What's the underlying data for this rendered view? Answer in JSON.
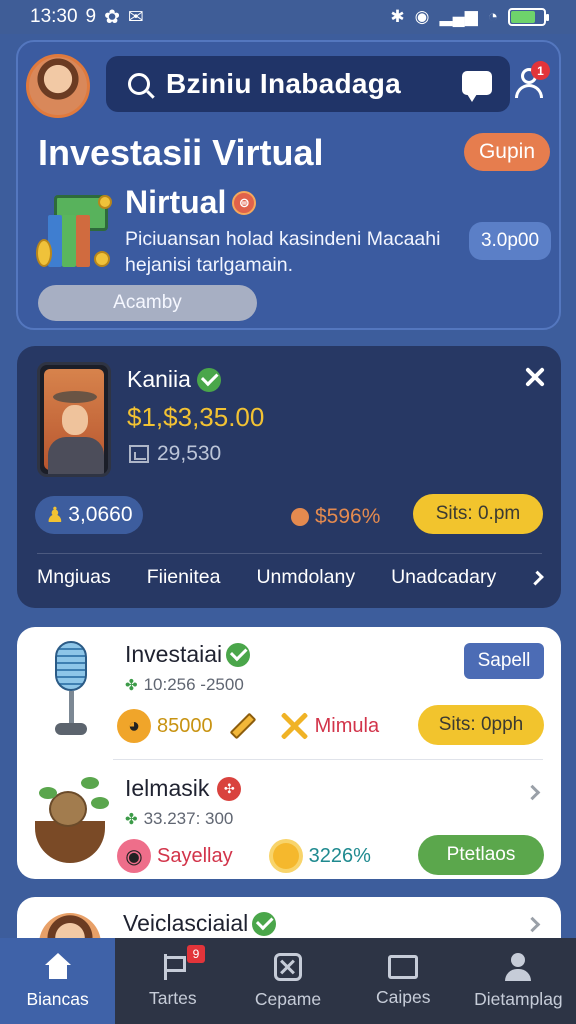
{
  "status_bar": {
    "time": "13:30",
    "extra": "9",
    "colors": {
      "battery": "#6ed36b"
    },
    "battery_level": 0.75
  },
  "header": {
    "search_text": "Bziniu Inabadaga",
    "notification_count": "1",
    "hero_title": "Investasii Virtual",
    "gupin_label": "Gupin",
    "hero_subtitle": "Nirtual",
    "hero_description": "Piciuansan holad kasindeni Macaahi hejanisi tarlgamain.",
    "amount_label": "3.0p00",
    "acamby_label": "Acamby"
  },
  "profile": {
    "name": "Kaniia",
    "balance": "$1,$3,35.00",
    "stat": "29,530",
    "points": "3,0660",
    "percent": "$596%",
    "sits_label": "Sits: 0.pm",
    "tabs": [
      "Mngiuas",
      "Fiienitea",
      "Unmdolany",
      "Unadcadary"
    ]
  },
  "list": {
    "items": [
      {
        "title": "Investaiai",
        "meta": "10:256 -2500",
        "action_label": "Sapell",
        "value1": "85000",
        "value2": "Mimula",
        "button_label": "Sits: 0pph"
      },
      {
        "title": "Ielmasik",
        "meta": "33.237: 300",
        "value1": "Sayellay",
        "value2": "3226%",
        "button_label": "Ptetlaos"
      }
    ],
    "peek_title": "Veiclasciaial"
  },
  "bottom_nav": [
    {
      "label": "Biancas",
      "icon": "home-icon",
      "active": true
    },
    {
      "label": "Tartes",
      "icon": "flag-icon",
      "badge": "9"
    },
    {
      "label": "Cepame",
      "icon": "x-box-icon"
    },
    {
      "label": "Caipes",
      "icon": "board-icon"
    },
    {
      "label": "Dietamplag",
      "icon": "person-icon"
    }
  ]
}
